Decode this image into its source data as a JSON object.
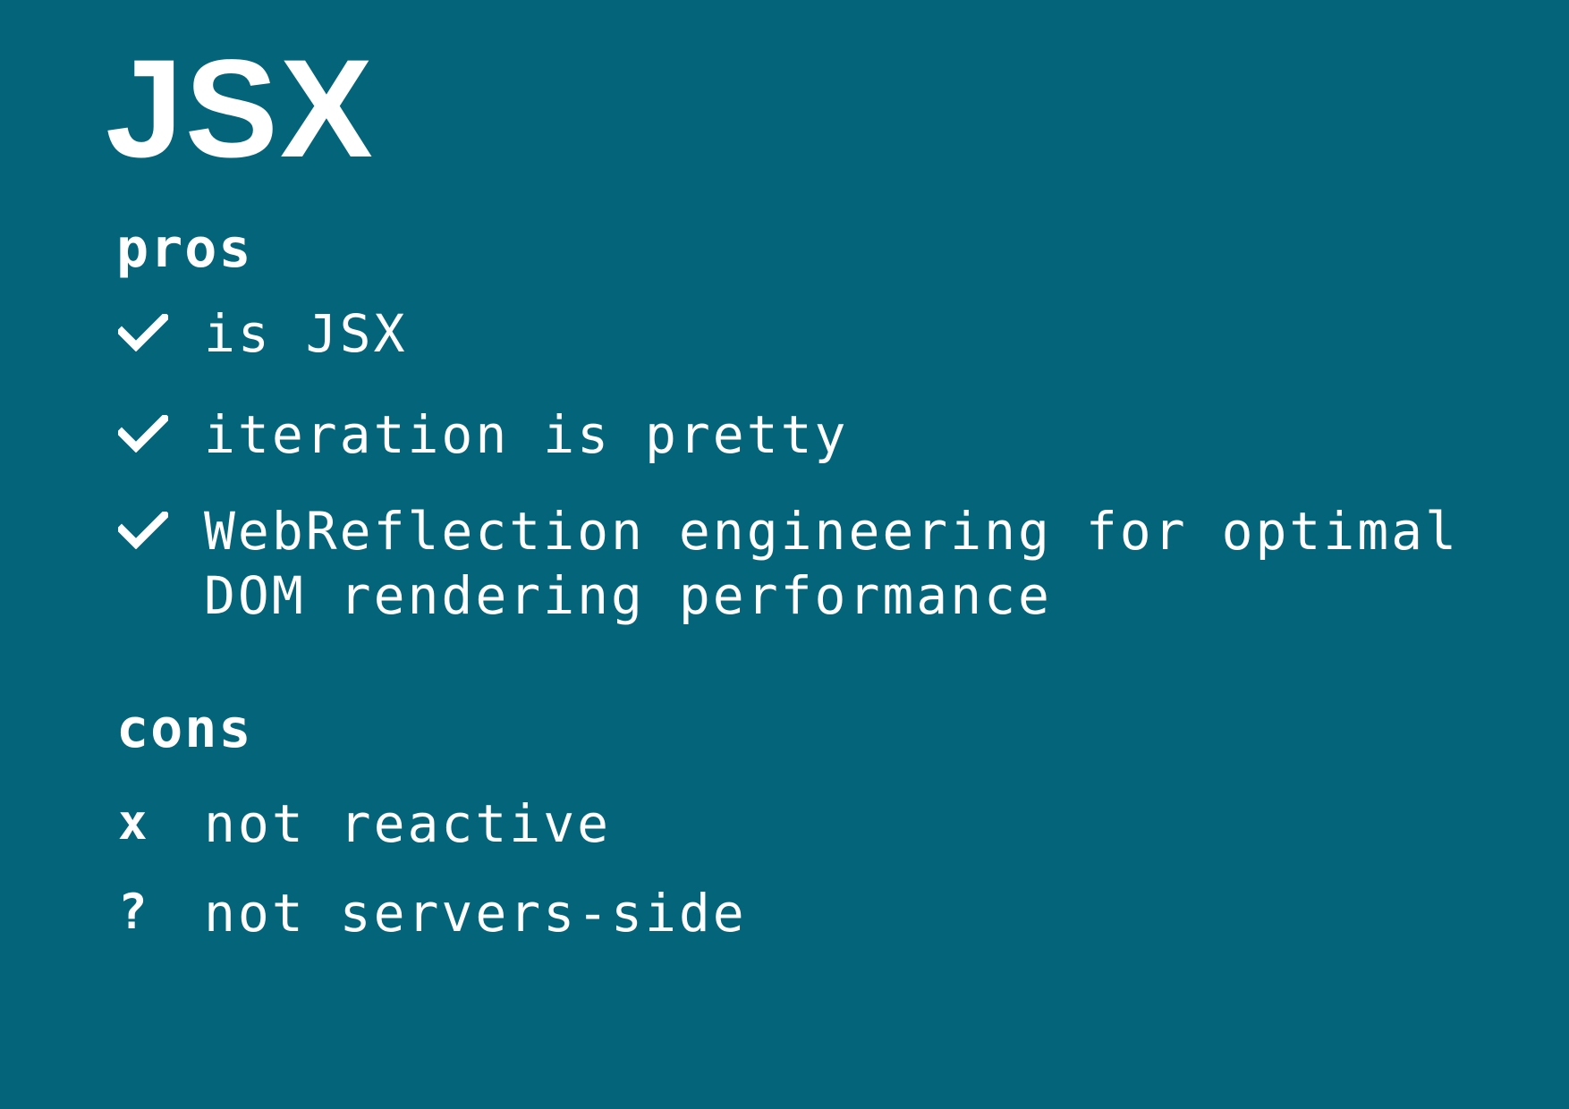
{
  "title": "JSX",
  "pros": {
    "heading": "pros",
    "items": [
      {
        "icon": "check-icon",
        "lines": [
          "is JSX"
        ]
      },
      {
        "icon": "check-icon",
        "lines": [
          "iteration is pretty"
        ]
      },
      {
        "icon": "check-icon",
        "lines": [
          "WebReflection engineering for optimal",
          "DOM rendering performance"
        ]
      }
    ]
  },
  "cons": {
    "heading": "cons",
    "items": [
      {
        "marker": "x",
        "text": "not reactive"
      },
      {
        "marker": "?",
        "text": "not servers-side"
      }
    ]
  },
  "colors": {
    "background": "#04657a",
    "foreground": "#ffffff"
  }
}
